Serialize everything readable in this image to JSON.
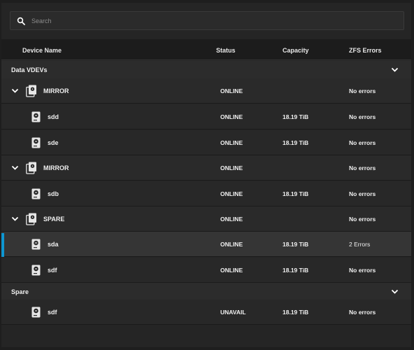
{
  "search": {
    "placeholder": "Search"
  },
  "columns": {
    "name": "Device Name",
    "status": "Status",
    "capacity": "Capacity",
    "errors": "ZFS Errors"
  },
  "groups": [
    {
      "label": "Data VDEVs"
    },
    {
      "label": "Spare"
    }
  ],
  "rows": [
    {
      "kind": "vdev",
      "name": "MIRROR",
      "status": "ONLINE",
      "capacity": "",
      "errors": "No errors"
    },
    {
      "kind": "disk",
      "name": "sdd",
      "status": "ONLINE",
      "capacity": "18.19 TiB",
      "errors": "No errors"
    },
    {
      "kind": "disk",
      "name": "sde",
      "status": "ONLINE",
      "capacity": "18.19 TiB",
      "errors": "No errors"
    },
    {
      "kind": "vdev",
      "name": "MIRROR",
      "status": "ONLINE",
      "capacity": "",
      "errors": "No errors"
    },
    {
      "kind": "disk",
      "name": "sdb",
      "status": "ONLINE",
      "capacity": "18.19 TiB",
      "errors": "No errors"
    },
    {
      "kind": "vdev",
      "name": "SPARE",
      "status": "ONLINE",
      "capacity": "",
      "errors": "No errors"
    },
    {
      "kind": "disk",
      "name": "sda",
      "status": "ONLINE",
      "capacity": "18.19 TiB",
      "errors": "2 Errors",
      "selected": true
    },
    {
      "kind": "disk",
      "name": "sdf",
      "status": "ONLINE",
      "capacity": "18.19 TiB",
      "errors": "No errors"
    },
    {
      "kind": "disk",
      "name": "sdf",
      "status": "UNAVAIL",
      "capacity": "18.19 TiB",
      "errors": "No errors"
    }
  ],
  "icons": {
    "search": "search-icon",
    "disk": "hard-disk-icon",
    "vdev": "disk-stack-icon",
    "expand": "chevron-down-icon",
    "collapse": "chevron-down-icon"
  },
  "colors": {
    "accent": "#0e96d1"
  }
}
